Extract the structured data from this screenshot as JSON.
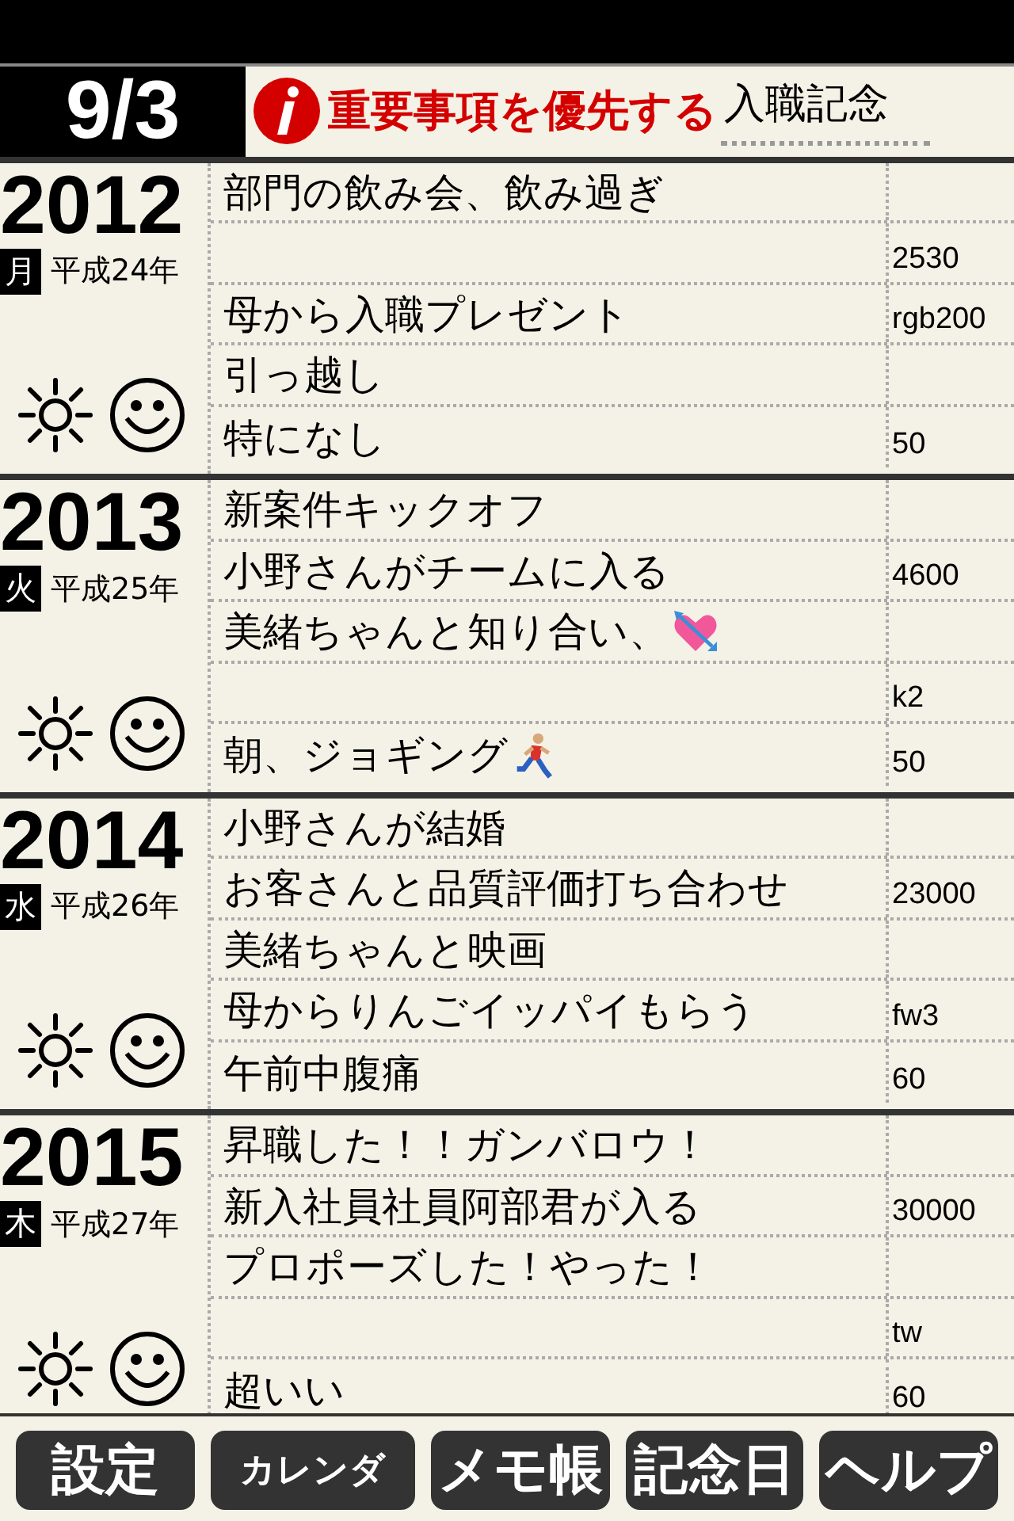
{
  "header": {
    "date": "9/3",
    "priority": "重要事項を優先する",
    "memo": "入職記念"
  },
  "years": [
    {
      "year": "2012",
      "weekday": "月",
      "era": "平成24年",
      "rows": [
        {
          "text": "部門の飲み会、飲み過ぎ"
        },
        {
          "value": "2530"
        },
        {
          "text": "母から入職プレゼント",
          "value": "rgb200"
        },
        {
          "text": "引っ越し"
        },
        {
          "text": "特になし",
          "value": "50"
        }
      ]
    },
    {
      "year": "2013",
      "weekday": "火",
      "era": "平成25年",
      "rows": [
        {
          "text": "新案件キックオフ"
        },
        {
          "text": "小野さんがチームに入る",
          "value": "4600"
        },
        {
          "text": "美緒ちゃんと知り合い、",
          "kind": "heart"
        },
        {
          "value": "k2"
        },
        {
          "text": "朝、ジョギング",
          "kind": "runner",
          "value": "50"
        }
      ]
    },
    {
      "year": "2014",
      "weekday": "水",
      "era": "平成26年",
      "rows": [
        {
          "text": "小野さんが結婚"
        },
        {
          "text": "お客さんと品質評価打ち合わせ",
          "value": "23000"
        },
        {
          "text": "美緒ちゃんと映画"
        },
        {
          "text": "母からりんごイッパイもらう",
          "value": "fw3"
        },
        {
          "text": "午前中腹痛",
          "value": "60"
        }
      ]
    },
    {
      "year": "2015",
      "weekday": "木",
      "era": "平成27年",
      "rows": [
        {
          "text": "昇職した！！ガンバロウ！"
        },
        {
          "text": "新入社員社員阿部君が入る",
          "value": "30000"
        },
        {
          "text": "プロポーズした！やった！"
        },
        {
          "value": "tw"
        },
        {
          "text": "超いい",
          "value": "60"
        }
      ]
    }
  ],
  "buttons": [
    {
      "label": "設定"
    },
    {
      "label": "カレンダ"
    },
    {
      "label": "メモ帳"
    },
    {
      "label": "記念日"
    },
    {
      "label": "ヘルプ"
    }
  ]
}
